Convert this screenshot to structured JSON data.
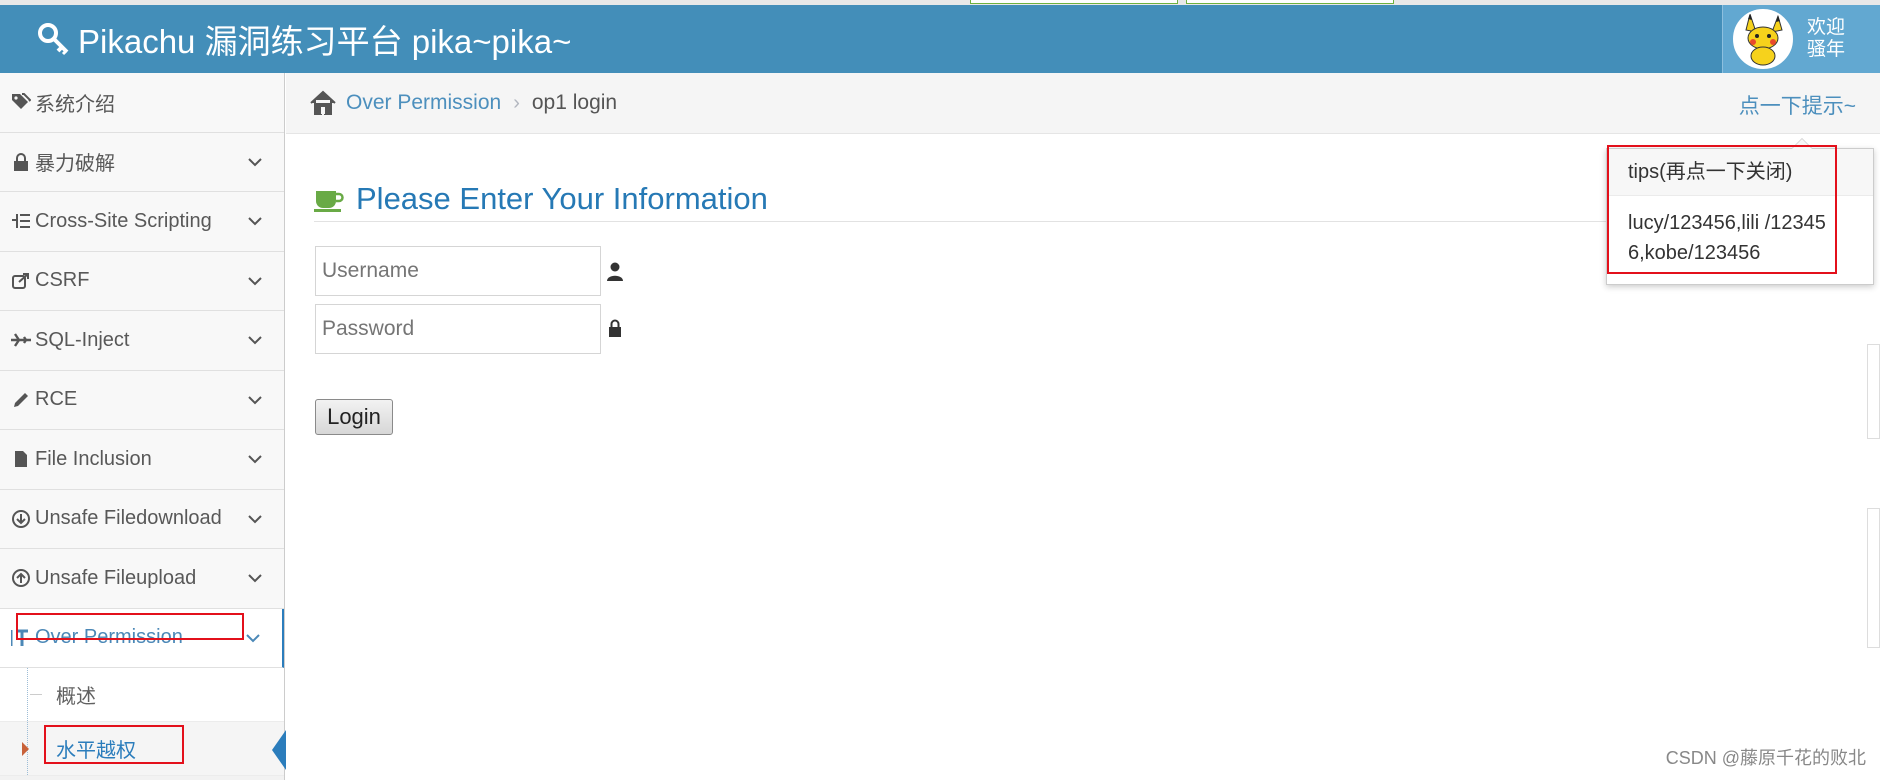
{
  "app": {
    "title": "Pikachu 漏洞练习平台 pika~pika~",
    "welcome_line1": "欢迎",
    "welcome_line2": "骚年"
  },
  "sidebar": {
    "items": [
      {
        "label": "系统介绍",
        "icon": "tags-icon",
        "expandable": false
      },
      {
        "label": "暴力破解",
        "icon": "lock-icon",
        "expandable": true
      },
      {
        "label": "Cross-Site Scripting",
        "icon": "sitemap-icon",
        "expandable": true
      },
      {
        "label": "CSRF",
        "icon": "share-icon",
        "expandable": true
      },
      {
        "label": "SQL-Inject",
        "icon": "plane-icon",
        "expandable": true
      },
      {
        "label": "RCE",
        "icon": "pencil-icon",
        "expandable": true
      },
      {
        "label": "File Inclusion",
        "icon": "file-icon",
        "expandable": true
      },
      {
        "label": "Unsafe Filedownload",
        "icon": "download-icon",
        "expandable": true
      },
      {
        "label": "Unsafe Fileupload",
        "icon": "upload-icon",
        "expandable": true
      },
      {
        "label": "Over Permission",
        "icon": "text-height-icon",
        "expandable": true,
        "active": true
      }
    ],
    "subitems": [
      {
        "label": "概述"
      },
      {
        "label": "水平越权",
        "active": true
      }
    ]
  },
  "breadcrumb": {
    "parent": "Over Permission",
    "separator": "›",
    "current": "op1 login",
    "hint_link": "点一下提示~"
  },
  "main": {
    "heading": "Please Enter Your Information",
    "username_placeholder": "Username",
    "password_placeholder": "Password",
    "login_label": "Login"
  },
  "popover": {
    "title": "tips(再点一下关闭)",
    "body": "lucy/123456,lili /123456,kobe/123456"
  },
  "watermark": "CSDN @藤原千花的败北",
  "colors": {
    "navbar": "#438eb9",
    "link": "#4c8fbd",
    "heading": "#2679b5",
    "annotation": "#e3101b"
  }
}
